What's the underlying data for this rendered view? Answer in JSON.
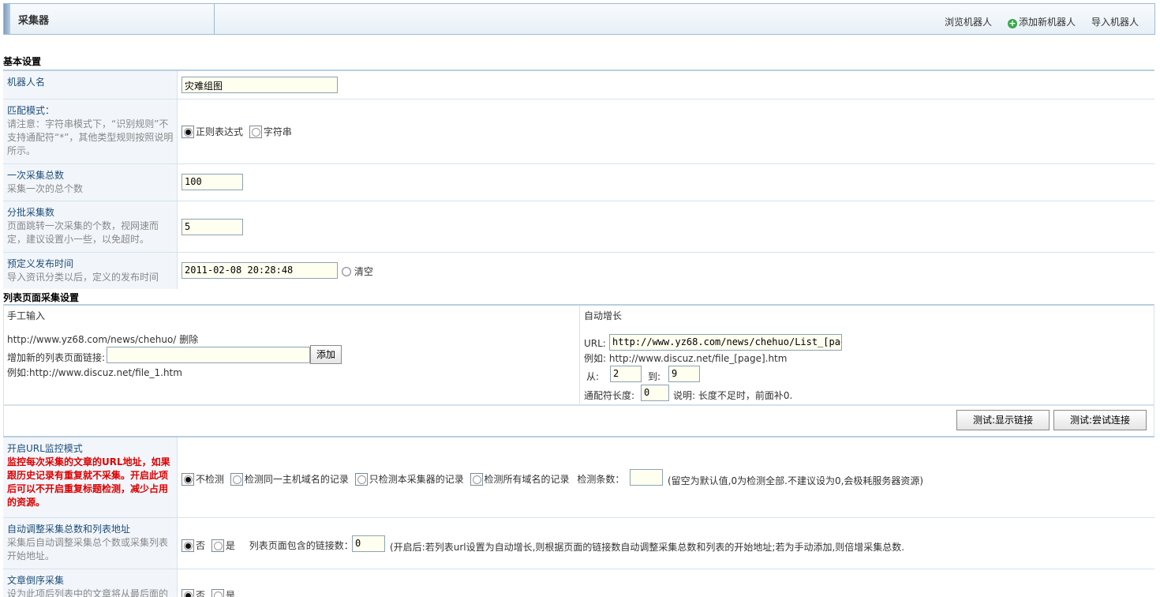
{
  "header": {
    "title": "采集器",
    "links": [
      "浏览机器人",
      "添加新机器人",
      "导入机器人"
    ]
  },
  "basic": {
    "section_title": "基本设置",
    "robot_name": {
      "label": "机器人名",
      "value": "灾难组图"
    },
    "match_mode": {
      "label": "匹配模式：",
      "desc": "请注意：字符串模式下，“识别规则”不支持通配符“*”，其他类型规则按照说明所示。",
      "options": [
        "正则表达式",
        "字符串"
      ],
      "selected": "正则表达式"
    },
    "total": {
      "label": "一次采集总数",
      "desc": "采集一次的总个数",
      "value": "100"
    },
    "batch": {
      "label": "分批采集数",
      "desc": "页面跳转一次采集的个数，视网速而定，建议设置小一些，以免超时。",
      "value": "5"
    },
    "publish_time": {
      "label": "预定义发布时间",
      "desc": "导入资讯分类以后，定义的发布时间",
      "value": "2011-02-08 20:28:48",
      "clear": "清空"
    }
  },
  "list": {
    "section_title": "列表页面采集设置",
    "manual": {
      "title": "手工输入",
      "url": "http://www.yz68.com/news/chehuo/",
      "delete": "删除",
      "add_label": "增加新的列表页面链接:",
      "add_value": "",
      "add_button": "添加",
      "example": "例如:http://www.discuz.net/file_1.htm"
    },
    "auto": {
      "title": "自动增长",
      "url_label": "URL:",
      "url_value": "http://www.yz68.com/news/chehuo/List_[pag",
      "example": "例如: http://www.discuz.net/file_[page].htm",
      "from_label": "从:",
      "from_value": "2",
      "to_label": "到:",
      "to_value": "9",
      "wildcard_label": "通配符长度:",
      "wildcard_value": "0",
      "wildcard_note": "说明: 长度不足时，前面补0."
    },
    "buttons": [
      "测试:显示链接",
      "测试:尝试连接"
    ]
  },
  "url_monitor": {
    "label": "开启URL监控模式",
    "desc": "监控每次采集的文章的URL地址，如果跟历史记录有重复就不采集。开启此项后可以不开启重复标题检测，减少占用的资源。",
    "options": [
      "不检测",
      "检测同一主机域名的记录",
      "只检测本采集器的记录",
      "检测所有域名的记录"
    ],
    "selected": "不检测",
    "count_label": "检测条数：",
    "count_value": "",
    "note": "(留空为默认值,0为检测全部.不建议设为0,会极耗服务器资源)"
  },
  "auto_adjust": {
    "label": "自动调整采集总数和列表地址",
    "desc": "采集后自动调整采集总个数或采集列表开始地址。",
    "options": [
      "否",
      "是"
    ],
    "selected": "否",
    "links_label": "列表页面包含的链接数：",
    "links_value": "0",
    "note": "(开启后:若列表url设置为自动增长,则根据页面的链接数自动调整采集总数和列表的开始地址;若为手动添加,则倍增采集总数."
  },
  "reverse": {
    "label": "文章倒序采集",
    "desc": "设为此项后列表中的文章将从最后面的",
    "options": [
      "否",
      "是"
    ],
    "selected": "否"
  }
}
